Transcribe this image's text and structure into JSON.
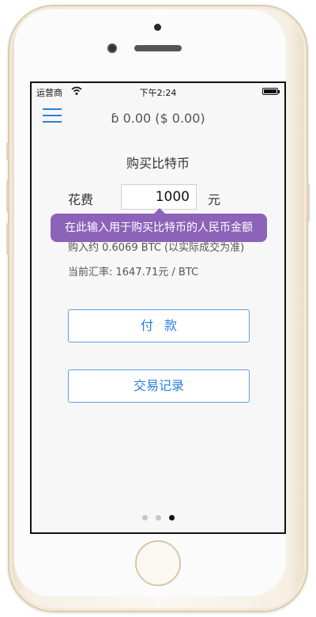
{
  "status_bar": {
    "carrier": "运营商",
    "time": "下午2:24"
  },
  "header": {
    "balance": "ɓ 0.00 ($ 0.00)"
  },
  "main": {
    "title": "购买比特币",
    "spend_label": "花费",
    "spend_value": "1000",
    "unit_label": "元",
    "buy_estimate": "购入约  0.6069  BTC (以实际成交为准)",
    "rate": "当前汇率:  1647.71元 / BTC"
  },
  "tooltip": {
    "text": "在此输入用于购买比特币的人民币金额"
  },
  "buttons": {
    "pay": "付款",
    "history": "交易记录"
  },
  "pagination": {
    "count": 3,
    "active_index": 2
  },
  "colors": {
    "accent": "#2a7fe0",
    "tooltip_bg": "#8c63b8"
  }
}
